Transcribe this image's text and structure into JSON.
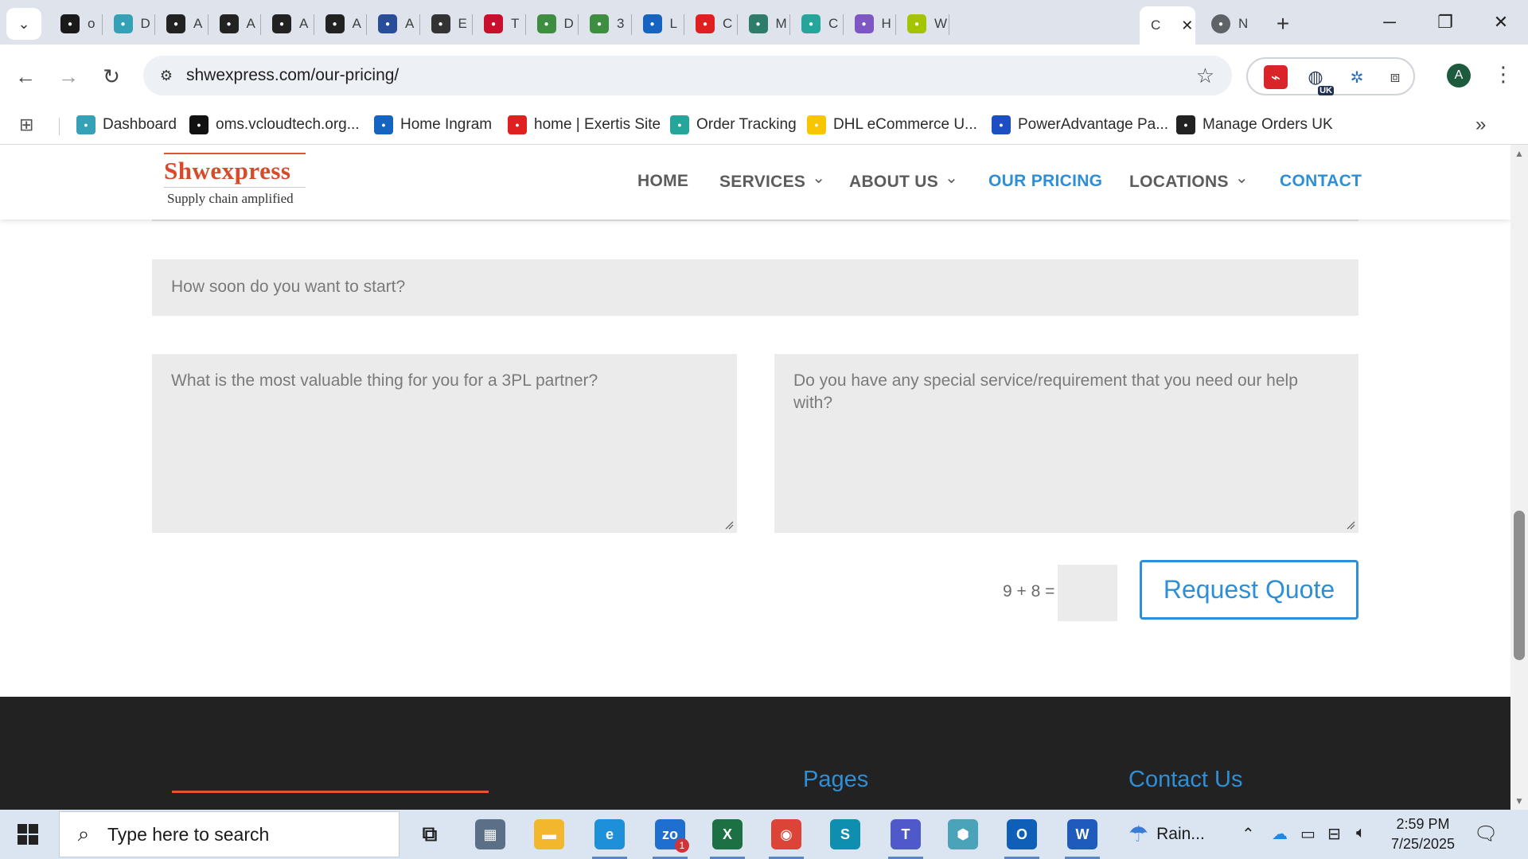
{
  "browser": {
    "tabs": [
      {
        "letter": "o",
        "icon": "vcloud-icon",
        "color": "#1a1a1a"
      },
      {
        "letter": "D",
        "icon": "dashboard-icon",
        "color": "#34a1b6"
      },
      {
        "letter": "A",
        "icon": "amazon-icon",
        "color": "#222222"
      },
      {
        "letter": "A",
        "icon": "amazon-icon",
        "color": "#222222"
      },
      {
        "letter": "A",
        "icon": "amazon-icon",
        "color": "#222222"
      },
      {
        "letter": "A",
        "icon": "amazon-icon",
        "color": "#222222"
      },
      {
        "letter": "A",
        "icon": "arrow-icon",
        "color": "#2a4d9b"
      },
      {
        "letter": "E",
        "icon": "openai-icon",
        "color": "#333333"
      },
      {
        "letter": "T",
        "icon": "t-icon",
        "color": "#c8102e"
      },
      {
        "letter": "D",
        "icon": "tractor-icon",
        "color": "#3e8e41"
      },
      {
        "letter": "3",
        "icon": "tractor-icon",
        "color": "#3e8e41"
      },
      {
        "letter": "L",
        "icon": "ingram-icon",
        "color": "#1565c0"
      },
      {
        "letter": "C",
        "icon": "exertis-icon",
        "color": "#e02020"
      },
      {
        "letter": "M",
        "icon": "leaf-icon",
        "color": "#2e7d6b"
      },
      {
        "letter": "C",
        "icon": "circle-c-icon",
        "color": "#26a69a"
      },
      {
        "letter": "H",
        "icon": "chart-icon",
        "color": "#7e57c2"
      },
      {
        "letter": "W",
        "icon": "infios-icon",
        "color": "#a4c400"
      }
    ],
    "active_tab": {
      "letter": "C",
      "close": "✕"
    },
    "after_tab": {
      "letter": "N",
      "icon": "chrome-icon"
    },
    "newtab": "+",
    "url": "shwexpress.com/our-pricing/",
    "extensions_badge": "UK",
    "profile_initial": "A",
    "bookmarks": [
      {
        "label": "Dashboard",
        "icon": "dashboard-icon",
        "color": "#34a1b6"
      },
      {
        "label": "oms.vcloudtech.org...",
        "icon": "vcloud-icon",
        "color": "#111111"
      },
      {
        "label": "Home Ingram",
        "icon": "ingram-icon",
        "color": "#1565c0"
      },
      {
        "label": "home | Exertis Site",
        "icon": "exertis-icon",
        "color": "#e02020"
      },
      {
        "label": "Order Tracking",
        "icon": "circle-c-icon",
        "color": "#26a69a"
      },
      {
        "label": "DHL eCommerce U...",
        "icon": "dhl-icon",
        "color": "#f7c600"
      },
      {
        "label": "PowerAdvantage Pa...",
        "icon": "poweradvantage-icon",
        "color": "#1e4fc2"
      },
      {
        "label": "Manage Orders UK",
        "icon": "amazon-icon",
        "color": "#222222"
      }
    ],
    "bookmarks_overflow": "»"
  },
  "site": {
    "logo_name": "Shwexpress",
    "logo_tagline": "Supply chain amplified",
    "nav": [
      {
        "label": "HOME",
        "dropdown": false,
        "blue": false
      },
      {
        "label": "SERVICES",
        "dropdown": true,
        "blue": false
      },
      {
        "label": "ABOUT US",
        "dropdown": true,
        "blue": false
      },
      {
        "label": "OUR PRICING",
        "dropdown": false,
        "blue": true
      },
      {
        "label": "LOCATIONS",
        "dropdown": true,
        "blue": false
      },
      {
        "label": "CONTACT",
        "dropdown": false,
        "blue": true
      }
    ],
    "form": {
      "start_placeholder": "How soon do you want to start?",
      "valuable_placeholder": "What is the most valuable thing for you for a 3PL partner?",
      "special_placeholder": "Do you have any special service/requirement that you need our help with?",
      "captcha_label": "9 + 8 =",
      "captcha_value": "",
      "submit_label": "Request Quote"
    },
    "footer": {
      "pages_heading": "Pages",
      "contact_heading": "Contact Us"
    },
    "colors": {
      "accent": "#2e8fd6",
      "brand": "#d94a2a",
      "footer_bg": "#222222"
    }
  },
  "taskbar": {
    "search_placeholder": "Type here to search",
    "apps": [
      {
        "name": "task-view",
        "label": "⧉",
        "color": "transparent"
      },
      {
        "name": "calculator",
        "label": "▦",
        "color": "#5b6f86"
      },
      {
        "name": "file-explorer",
        "label": "▬",
        "color": "#f2b72d"
      },
      {
        "name": "edge",
        "label": "e",
        "color": "#1e8fd9"
      },
      {
        "name": "zoho",
        "label": "zo",
        "color": "#1f6fd0"
      },
      {
        "name": "excel",
        "label": "X",
        "color": "#1d7044"
      },
      {
        "name": "chrome",
        "label": "◉",
        "color": "#db4437"
      },
      {
        "name": "sway",
        "label": "S",
        "color": "#0f8fb0"
      },
      {
        "name": "teams",
        "label": "T",
        "color": "#5059c9"
      },
      {
        "name": "app-hex",
        "label": "⬢",
        "color": "#4aa3b8"
      },
      {
        "name": "outlook",
        "label": "O",
        "color": "#0f5fb8"
      },
      {
        "name": "word",
        "label": "W",
        "color": "#1e5bbd"
      }
    ],
    "zoho_badge": "1",
    "weather": "Rain...",
    "time": "2:59 PM",
    "date": "7/25/2025"
  }
}
